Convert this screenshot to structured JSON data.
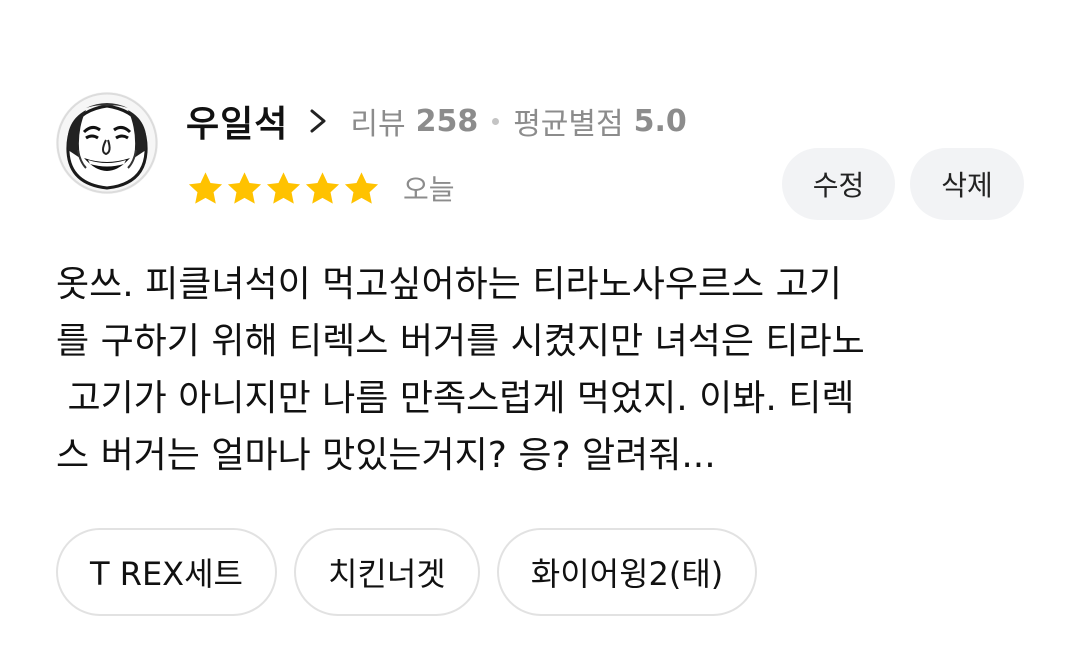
{
  "review": {
    "user_name": "우일석",
    "review_count_label": "리뷰",
    "review_count": "258",
    "avg_rating_label": "평균별점",
    "avg_rating": "5.0",
    "stars": 5,
    "star_color": "#ffc200",
    "date": "오늘",
    "edit_label": "수정",
    "delete_label": "삭제",
    "text_lines": [
      "옷쓰. 피클녀석이 먹고싶어하는 티라노사우르스 고기",
      "를 구하기 위해 티렉스 버거를 시켰지만 녀석은 티라노",
      " 고기가 아니지만 나름 만족스럽게 먹었지. 이봐. 티렉",
      "스 버거는 얼마나 맛있는거지? 응? 알려줘..."
    ],
    "menu_tags": [
      "T REX세트",
      "치킨너겟",
      "화이어윙2(태)"
    ]
  },
  "icons": {
    "profile": "avatar-caricature",
    "chevron": "chevron-right-icon",
    "star": "star-icon"
  }
}
